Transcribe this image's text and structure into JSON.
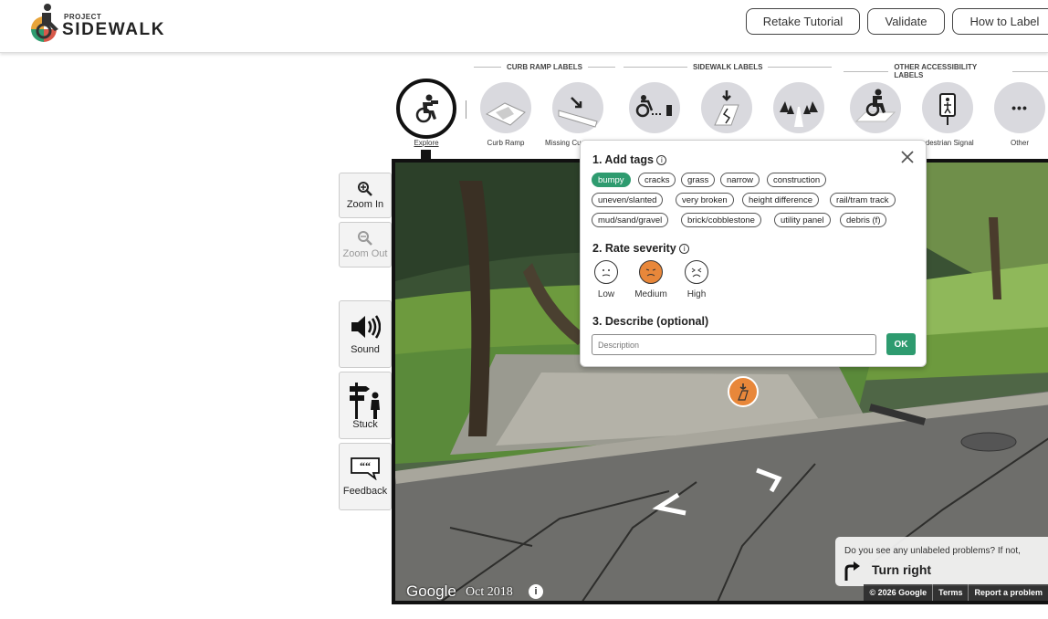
{
  "header": {
    "logo_small": "PROJECT",
    "logo_big": "SIDEWALK",
    "buttons": [
      "Retake Tutorial",
      "Validate",
      "How to Label"
    ]
  },
  "toolbar": {
    "groups": [
      "CURB RAMP LABELS",
      "SIDEWALK LABELS",
      "OTHER ACCESSIBILITY LABELS"
    ],
    "explore_label": "Explore",
    "curb_ramp_label": "Curb Ramp",
    "missing_curb_label": "Missing Cu",
    "pedestrian_signal_label": "edestrian Signal",
    "other_label": "Other",
    "other_icon": "•••"
  },
  "side": {
    "zoom_in": "Zoom In",
    "zoom_out": "Zoom Out",
    "sound": "Sound",
    "stuck": "Stuck",
    "feedback": "Feedback"
  },
  "popup": {
    "tags_heading": "1. Add tags",
    "tags": [
      {
        "label": "bumpy",
        "selected": true
      },
      {
        "label": "cracks",
        "selected": false
      },
      {
        "label": "grass",
        "selected": false
      },
      {
        "label": "narrow",
        "selected": false
      },
      {
        "label": "construction",
        "selected": false
      },
      {
        "label": "uneven/slanted",
        "selected": false
      },
      {
        "label": "very broken",
        "selected": false
      },
      {
        "label": "height difference",
        "selected": false
      },
      {
        "label": "rail/tram track",
        "selected": false
      },
      {
        "label": "mud/sand/gravel",
        "selected": false
      },
      {
        "label": "brick/cobblestone",
        "selected": false
      },
      {
        "label": "utility panel",
        "selected": false
      },
      {
        "label": "debris (f)",
        "selected": false
      }
    ],
    "severity_heading": "2. Rate severity",
    "severity": [
      {
        "label": "Low",
        "selected": false
      },
      {
        "label": "Medium",
        "selected": true
      },
      {
        "label": "High",
        "selected": false
      }
    ],
    "describe_heading": "3. Describe (optional)",
    "description_placeholder": "Description",
    "ok_label": "OK"
  },
  "pano": {
    "nav_question": "Do you see any unlabeled problems? If not,",
    "nav_action": "Turn right",
    "google_logo": "Google",
    "capture_date": "Oct 2018",
    "footer": [
      "© 2026 Google",
      "Terms",
      "Report a problem"
    ]
  },
  "colors": {
    "accent_green": "#2e9b6f",
    "marker_orange": "#e8873a"
  }
}
